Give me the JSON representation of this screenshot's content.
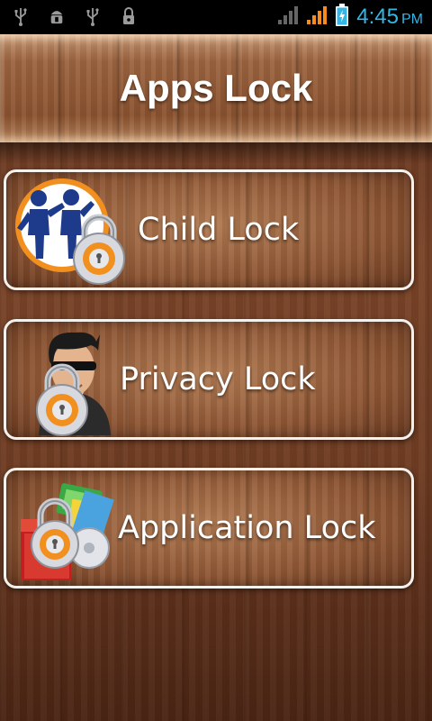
{
  "status_bar": {
    "time": "4:45",
    "ampm": "PM",
    "icons_left": [
      "usb-icon",
      "android-debug-icon",
      "usb-icon",
      "lock-notification-icon"
    ],
    "icons_right": [
      "signal-icon",
      "signal-icon",
      "battery-charging-icon"
    ]
  },
  "header": {
    "title": "Apps Lock"
  },
  "menu": {
    "items": [
      {
        "label": "Child Lock",
        "icon": "child-lock-icon"
      },
      {
        "label": "Privacy Lock",
        "icon": "privacy-lock-icon"
      },
      {
        "label": "Application Lock",
        "icon": "application-lock-icon"
      }
    ]
  },
  "colors": {
    "clock": "#33b5e5",
    "signal_active": "#f68b1e",
    "button_border": "#f4f0ec"
  }
}
